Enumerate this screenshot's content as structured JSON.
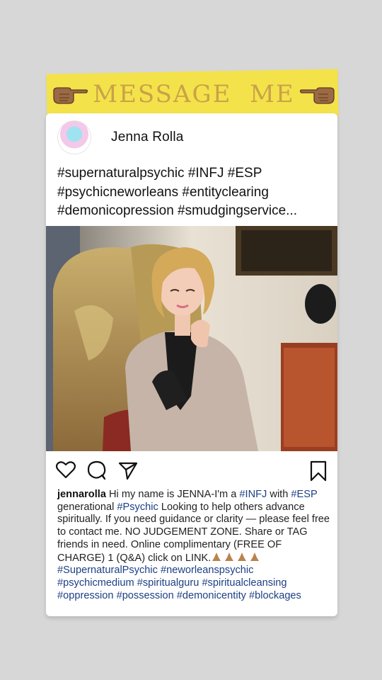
{
  "banner": {
    "text": "MESSAGE  ME",
    "left_icon": "pointing-right-hand-icon",
    "right_icon": "pointing-left-hand-icon"
  },
  "post": {
    "username": "Jenna Rolla",
    "hashtag_lines": [
      "#supernaturalpsychic #INFJ #ESP",
      "#psychicneworleans #entityclearing",
      "#demonicopression #smudgingservice..."
    ],
    "actions": {
      "like_icon": "heart-icon",
      "comment_icon": "comment-icon",
      "share_icon": "send-icon",
      "save_icon": "bookmark-icon"
    },
    "caption": {
      "username": "jennarolla",
      "t1": " Hi my name is JENNA-I'm a ",
      "h1": "#INFJ",
      "t2": " with ",
      "h2": "#ESP",
      "t3": " generational ",
      "h3": "#Psychic",
      "t4": " Looking to help others advance spiritually. If you need guidance or clarity — please feel free to contact me. NO JUDGEMENT ZONE. Share or TAG friends in need. Online complimentary (FREE OF CHARGE) 1 (Q&A) click on LINK.",
      "h4": "#SupernaturalPsychic",
      "h5": "#neworleanspsychic",
      "h6": "#psychicmedium",
      "h7": "#spiritualguru",
      "h8": "#spiritualcleansing",
      "h9": "#oppression",
      "h10": "#possession",
      "h11": "#demonicentity",
      "h12": "#blockages"
    }
  },
  "colors": {
    "banner_bg": "#f4e24b",
    "banner_text": "#c9a247",
    "hashtag": "#1d3f84",
    "background": "#d7d7d7"
  }
}
